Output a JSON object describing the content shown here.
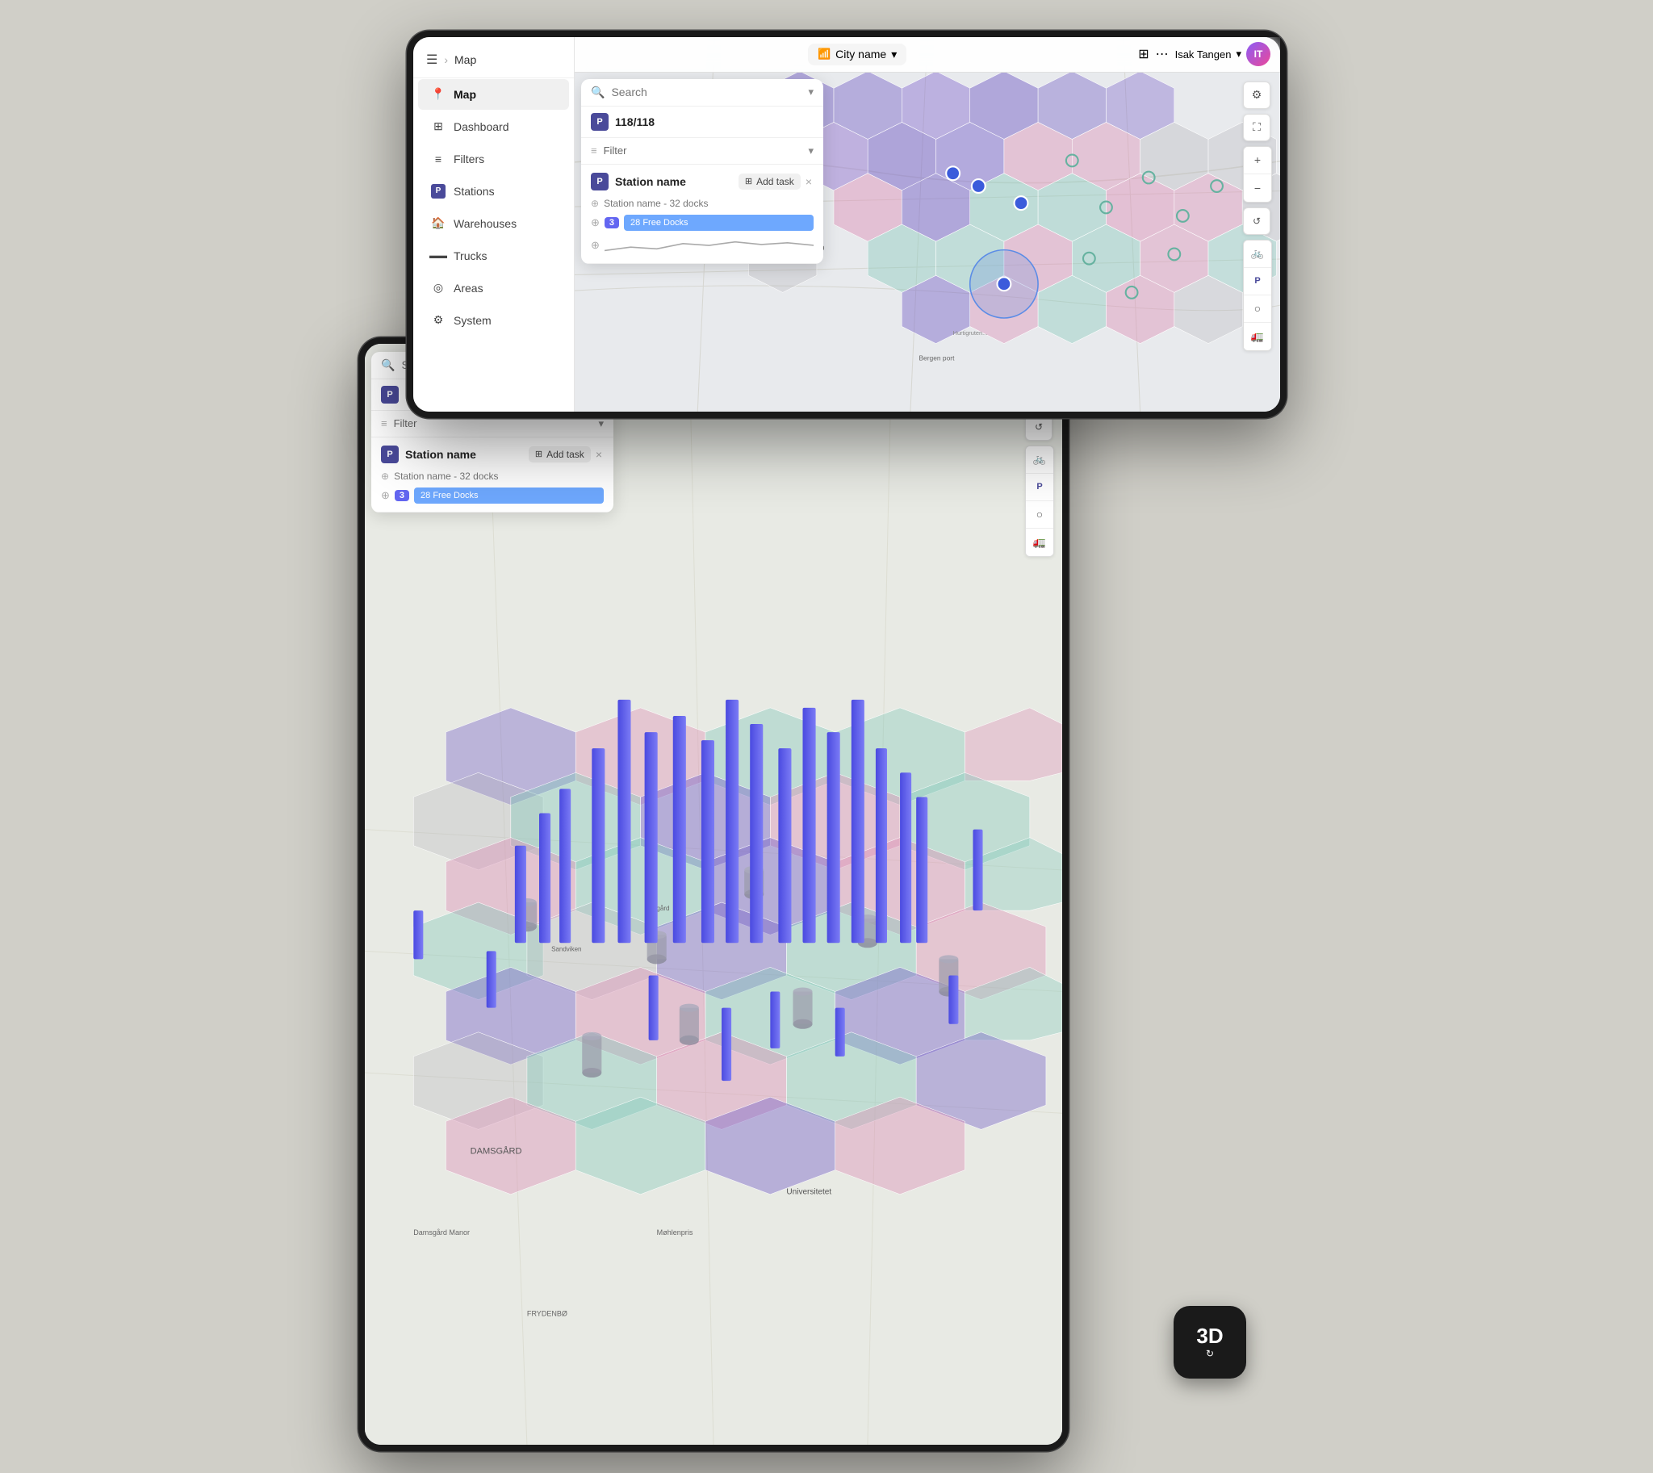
{
  "app": {
    "title": "Map",
    "breadcrumb_sep": ">",
    "page_label": "Map"
  },
  "topbar": {
    "menu_icon": "☰",
    "breadcrumb": "Map",
    "city_icon": "📶",
    "city_name": "City name",
    "chevron": "▾",
    "grid_icon": "⊞",
    "dots_icon": "⋯",
    "user_name": "Isak Tangen",
    "user_chevron": "▾",
    "settings_icon": "⚙",
    "fullscreen_icon": "⛶"
  },
  "sidebar": {
    "items": [
      {
        "id": "map",
        "label": "Map",
        "icon": "📍",
        "active": true
      },
      {
        "id": "dashboard",
        "label": "Dashboard",
        "icon": "⊞",
        "active": false
      },
      {
        "id": "filters",
        "label": "Filters",
        "icon": "≡",
        "active": false
      },
      {
        "id": "stations",
        "label": "Stations",
        "icon": "P",
        "active": false
      },
      {
        "id": "warehouses",
        "label": "Warehouses",
        "icon": "🏠",
        "active": false
      },
      {
        "id": "trucks",
        "label": "Trucks",
        "icon": "▬",
        "active": false
      },
      {
        "id": "areas",
        "label": "Areas",
        "icon": "◎",
        "active": false
      },
      {
        "id": "system",
        "label": "System",
        "icon": "⚙",
        "active": false
      }
    ]
  },
  "panel": {
    "search_placeholder": "Search",
    "count_icon": "P",
    "count_value": "118/118",
    "filter_label": "Filter",
    "chevron_down": "▾",
    "station": {
      "name": "Station name",
      "parking_icon": "P",
      "add_task_label": "Add task",
      "close_icon": "×",
      "sub_label": "Station name - 32 docks",
      "dock_number": "3",
      "free_docks_label": "28 Free Docks"
    }
  },
  "map_controls": {
    "settings": "⚙",
    "expand": "⛶",
    "zoom_in": "+",
    "zoom_out": "−",
    "bike_icon": "🚲",
    "parking_icon": "P",
    "circle_icon": "○",
    "truck_icon": "🚛",
    "reset_icon": "↺"
  },
  "btn_3d": {
    "label": "3D",
    "icon": "↻"
  },
  "zoom": {
    "plus": "+",
    "minus": "−"
  },
  "colors": {
    "accent_purple": "#6366f1",
    "accent_blue": "#3b5bdb",
    "bar_color": "#5b5bea",
    "hex_purple": "rgba(120,100,200,0.45)",
    "hex_pink": "rgba(220,140,180,0.4)",
    "hex_teal": "rgba(130,200,185,0.35)",
    "panel_bg": "#ffffff",
    "sidebar_bg": "#ffffff"
  }
}
